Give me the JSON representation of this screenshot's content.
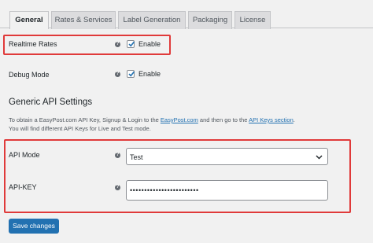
{
  "tabs": [
    {
      "label": "General",
      "active": true
    },
    {
      "label": "Rates & Services",
      "active": false
    },
    {
      "label": "Label Generation",
      "active": false
    },
    {
      "label": "Packaging",
      "active": false
    },
    {
      "label": "License",
      "active": false
    }
  ],
  "realtime_rates": {
    "label": "Realtime Rates",
    "checkbox_label": "Enable",
    "checked": true
  },
  "debug_mode": {
    "label": "Debug Mode",
    "checkbox_label": "Enable",
    "checked": true
  },
  "generic_api": {
    "title": "Generic API Settings",
    "desc_part1": "To obtain a EasyPost.com API Key, Signup & Login to the ",
    "desc_link1": "EasyPost.com",
    "desc_part2": " and then go to the ",
    "desc_link2": "API Keys section",
    "desc_part3": ".",
    "desc_line2": "You will find different API Keys for Live and Test mode."
  },
  "api_mode": {
    "label": "API Mode",
    "value": "Test"
  },
  "api_key": {
    "label": "API-KEY",
    "value": "••••••••••••••••••••••••"
  },
  "save_button": {
    "label": "Save changes"
  },
  "help_icon_glyph": "?",
  "colors": {
    "accent": "#2271b1",
    "highlight": "#e03a3a"
  }
}
